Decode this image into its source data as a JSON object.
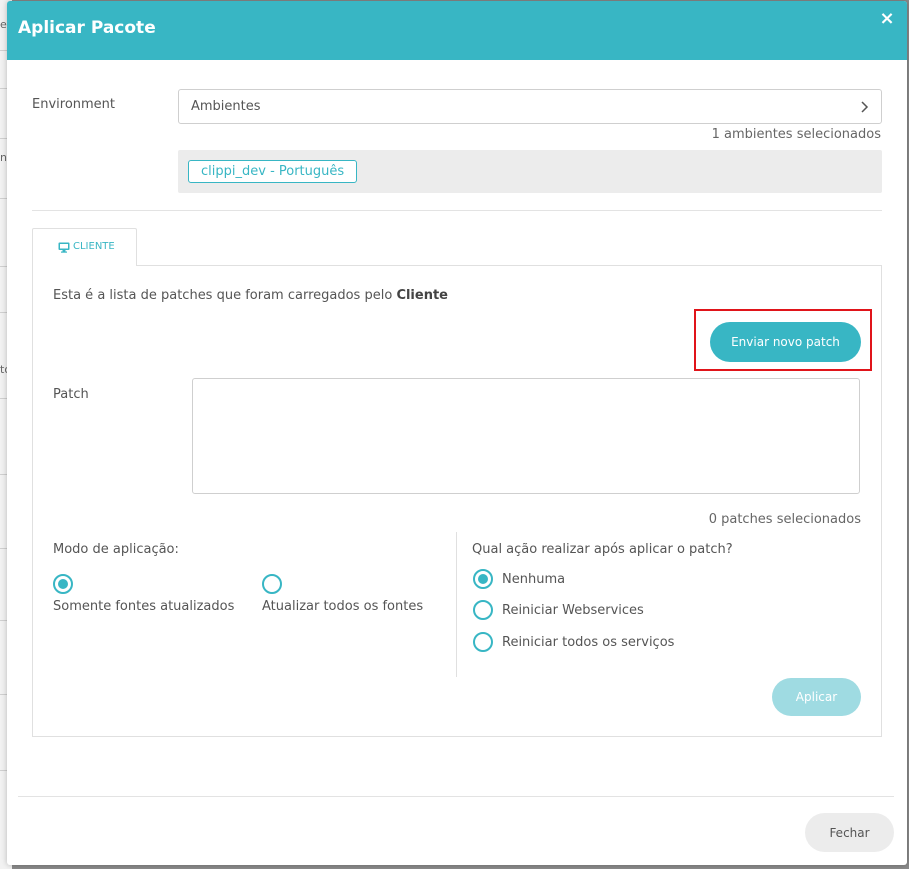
{
  "background": {
    "fragments": [
      "e",
      "na",
      "to"
    ]
  },
  "modal": {
    "title": "Aplicar Pacote",
    "close_glyph": "×"
  },
  "environment": {
    "label": "Environment",
    "select_value": "Ambientes",
    "count_text": "1 ambientes selecionados",
    "tags": [
      "clippi_dev - Português"
    ]
  },
  "tabs": [
    {
      "label": "CLIENTE",
      "icon": "monitor-icon",
      "active": true
    }
  ],
  "panel": {
    "description_prefix": "Esta é a lista de patches que foram carregados pelo",
    "description_bold": "Cliente",
    "send_button": "Enviar novo patch",
    "patch_label": "Patch",
    "patch_value": "",
    "patch_count_text": "0 patches selecionados",
    "mode": {
      "label": "Modo de aplicação:",
      "options": [
        {
          "label": "Somente fontes atualizados",
          "checked": true
        },
        {
          "label": "Atualizar todos os fontes",
          "checked": false
        }
      ]
    },
    "action": {
      "label": "Qual ação realizar após aplicar o patch?",
      "options": [
        {
          "label": "Nenhuma",
          "checked": true
        },
        {
          "label": "Reiniciar Webservices",
          "checked": false
        },
        {
          "label": "Reiniciar todos os serviços",
          "checked": false
        }
      ]
    },
    "apply_button": "Aplicar"
  },
  "footer": {
    "close_button": "Fechar"
  },
  "colors": {
    "accent": "#38b6c4",
    "highlight": "#e0141a",
    "apply_disabled": "#9fdbe2"
  }
}
